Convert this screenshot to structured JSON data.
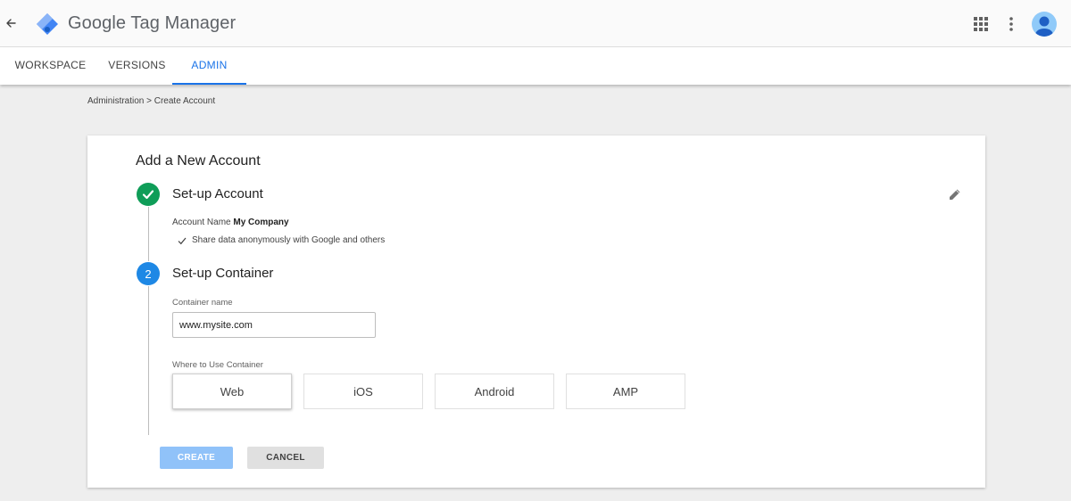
{
  "header": {
    "product_name": "Google Tag Manager",
    "back_icon": "arrow-left-icon",
    "apps_icon": "apps-grid-icon",
    "more_icon": "more-vert-icon",
    "avatar_icon": "account-avatar-icon"
  },
  "tabs": [
    {
      "label": "WORKSPACE",
      "active": false
    },
    {
      "label": "VERSIONS",
      "active": false
    },
    {
      "label": "ADMIN",
      "active": true
    }
  ],
  "breadcrumb": "Administration > Create Account",
  "card": {
    "title": "Add a New Account",
    "step1": {
      "title": "Set-up Account",
      "status": "complete",
      "account_name_label": "Account Name",
      "account_name_value": "My Company",
      "share_text": "Share data anonymously with Google and others"
    },
    "step2": {
      "number": "2",
      "title": "Set-up Container",
      "container_name_label": "Container name",
      "container_name_value": "www.mysite.com",
      "where_label": "Where to Use Container",
      "options": [
        {
          "label": "Web",
          "selected": true
        },
        {
          "label": "iOS",
          "selected": false
        },
        {
          "label": "Android",
          "selected": false
        },
        {
          "label": "AMP",
          "selected": false
        }
      ]
    },
    "buttons": {
      "create_label": "CREATE",
      "cancel_label": "CANCEL"
    }
  },
  "colors": {
    "accent": "#1a73e8",
    "step_complete": "#0f9d58",
    "step_active": "#1e88e5",
    "create_disabled": "#90c2f9"
  }
}
